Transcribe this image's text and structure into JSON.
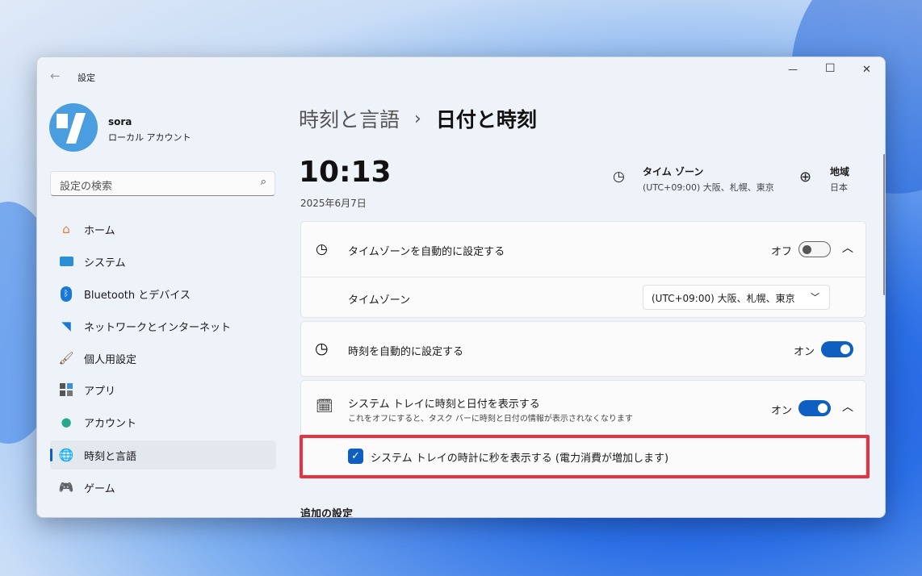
{
  "window": {
    "title": "設定",
    "minimize": "—",
    "maximize": "☐",
    "close": "✕"
  },
  "user": {
    "name": "sora",
    "type": "ローカル アカウント"
  },
  "search": {
    "placeholder": "設定の検索"
  },
  "sidebar": {
    "items": [
      {
        "label": "ホーム",
        "icon": "home-icon"
      },
      {
        "label": "システム",
        "icon": "system-icon"
      },
      {
        "label": "Bluetooth とデバイス",
        "icon": "bluetooth-icon"
      },
      {
        "label": "ネットワークとインターネット",
        "icon": "wifi-icon"
      },
      {
        "label": "個人用設定",
        "icon": "brush-icon"
      },
      {
        "label": "アプリ",
        "icon": "apps-icon"
      },
      {
        "label": "アカウント",
        "icon": "account-icon"
      },
      {
        "label": "時刻と言語",
        "icon": "time-language-icon"
      },
      {
        "label": "ゲーム",
        "icon": "gaming-icon"
      }
    ]
  },
  "breadcrumb": {
    "parent": "時刻と言語",
    "sep": "›",
    "current": "日付と時刻"
  },
  "clock": {
    "time": "10:13",
    "date": "2025年6月7日"
  },
  "timezone_info": {
    "label": "タイム ゾーン",
    "value": "(UTC+09:00) 大阪、札幌、東京"
  },
  "region_info": {
    "label": "地域",
    "value": "日本"
  },
  "settings": {
    "auto_timezone": {
      "label": "タイムゾーンを自動的に設定する",
      "state": "オフ"
    },
    "timezone": {
      "label": "タイムゾーン",
      "value": "(UTC+09:00) 大阪、札幌、東京"
    },
    "auto_time": {
      "label": "時刻を自動的に設定する",
      "state": "オン"
    },
    "tray": {
      "label": "システム トレイに時刻と日付を表示する",
      "desc": "これをオフにすると、タスク バーに時刻と日付の情報が表示されなくなります",
      "state": "オン"
    },
    "seconds": {
      "label": "システム トレイの時計に秒を表示する (電力消費が増加します)",
      "checked": true
    }
  },
  "additional": {
    "title": "追加の設定"
  },
  "colors": {
    "accent": "#0f5fc2",
    "highlight": "#e8323f"
  }
}
